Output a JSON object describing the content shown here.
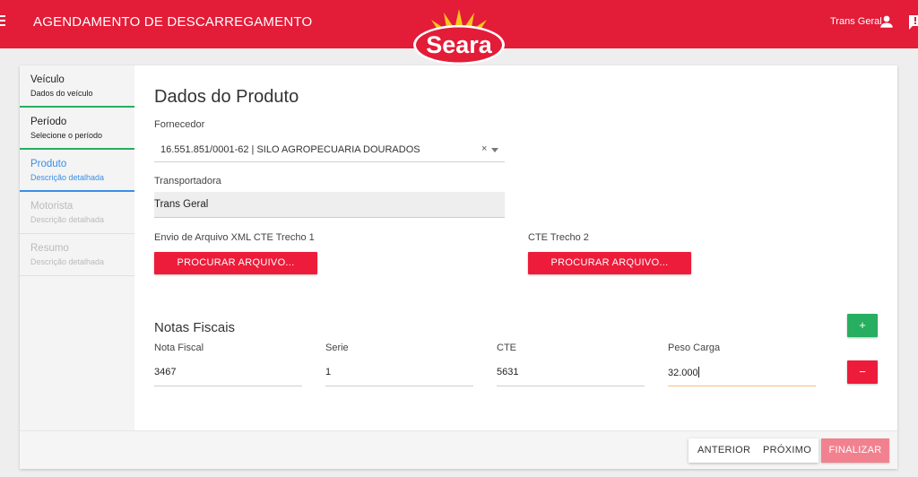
{
  "header": {
    "title": "AGENDAMENTO DE DESCARREGAMENTO",
    "user_name": "Trans Geral",
    "logo_text": "Seara",
    "accent_color": "#e31c38"
  },
  "steps": [
    {
      "title": "Veículo",
      "subtitle": "Dados do veículo",
      "state": "done"
    },
    {
      "title": "Período",
      "subtitle": "Selecione o período",
      "state": "done"
    },
    {
      "title": "Produto",
      "subtitle": "Descrição detalhada",
      "state": "active"
    },
    {
      "title": "Motorista",
      "subtitle": "Descrição detalhada",
      "state": "disabled"
    },
    {
      "title": "Resumo",
      "subtitle": "Descrição detalhada",
      "state": "disabled"
    }
  ],
  "form": {
    "title": "Dados do Produto",
    "fornecedor_label": "Fornecedor",
    "fornecedor_value": "16.551.851/0001-62 | SILO AGROPECUARIA DOURADOS",
    "clear_symbol": "×",
    "transportadora_label": "Transportadora",
    "transportadora_value": "Trans Geral",
    "upload1_label": "Envio de Arquivo XML CTE Trecho 1",
    "upload1_button": "PROCURAR ARQUIVO...",
    "upload2_label": "CTE Trecho 2",
    "upload2_button": "PROCURAR ARQUIVO..."
  },
  "notas": {
    "title": "Notas Fiscais",
    "add_symbol": "+",
    "remove_symbol": "−",
    "columns": [
      "Nota Fiscal",
      "Serie",
      "CTE",
      "Peso Carga"
    ],
    "row": [
      "3467",
      "1",
      "5631",
      "32.000"
    ]
  },
  "footer": {
    "anterior": "ANTERIOR",
    "proximo": "PRÓXIMO",
    "finalizar": "FINALIZAR"
  }
}
